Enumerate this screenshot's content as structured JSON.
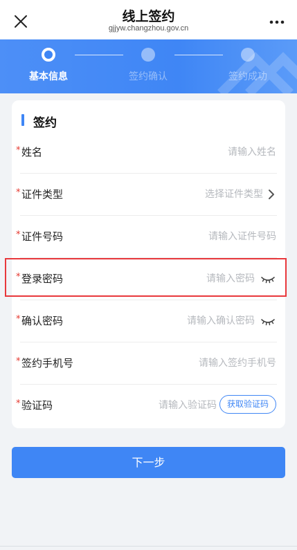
{
  "header": {
    "title": "线上签约",
    "domain": "gjjyw.changzhou.gov.cn"
  },
  "steps": [
    {
      "label": "基本信息",
      "state": "active"
    },
    {
      "label": "签约确认",
      "state": "inactive"
    },
    {
      "label": "签约成功",
      "state": "inactive"
    }
  ],
  "form": {
    "section_title": "签约",
    "fields": [
      {
        "label": "姓名",
        "placeholder": "请输入姓名",
        "required": true
      },
      {
        "label": "证件类型",
        "placeholder": "选择证件类型",
        "required": true,
        "trailing": "chevron-right-icon"
      },
      {
        "label": "证件号码",
        "placeholder": "请输入证件号码",
        "required": true
      },
      {
        "label": "登录密码",
        "placeholder": "请输入密码",
        "required": true,
        "trailing": "eye-closed-icon"
      },
      {
        "label": "确认密码",
        "placeholder": "请输入确认密码",
        "required": true,
        "trailing": "eye-closed-icon"
      },
      {
        "label": "签约手机号",
        "placeholder": "请输入签约手机号",
        "required": true
      },
      {
        "label": "验证码",
        "placeholder": "请输入验证码",
        "required": true,
        "button": "获取验证码"
      }
    ],
    "required_mark": "*"
  },
  "actions": {
    "next_label": "下一步"
  },
  "colors": {
    "primary": "#3f86f5",
    "required": "#e5382f",
    "highlight": "#e8373b",
    "placeholder": "#b6b9be",
    "page_background": "#f1f3f6"
  }
}
